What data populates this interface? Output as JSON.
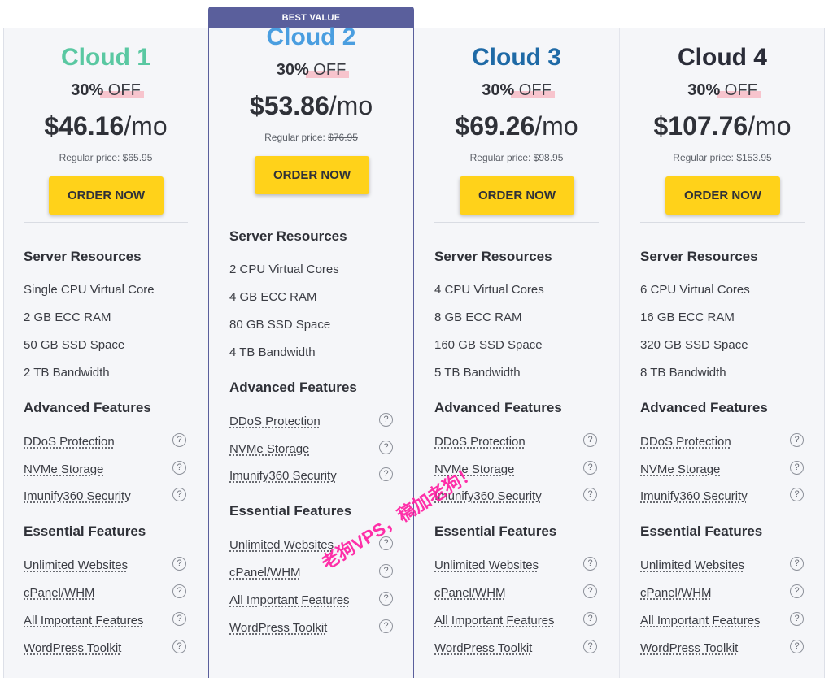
{
  "badge": "BEST VALUE",
  "plans": [
    {
      "name": "Cloud 1",
      "name_color": "#5ac8a2",
      "discount_pct": "30%",
      "discount_off": "OFF",
      "price": "$46.16",
      "per": "/mo",
      "regular_label": "Regular price:",
      "regular_price": "$65.95",
      "order_label": "ORDER NOW",
      "resources": [
        "Single CPU Virtual Core",
        "2 GB ECC RAM",
        "50 GB SSD Space",
        "2 TB Bandwidth"
      ]
    },
    {
      "name": "Cloud 2",
      "name_color": "#4a9ee0",
      "discount_pct": "30%",
      "discount_off": "OFF",
      "price": "$53.86",
      "per": "/mo",
      "regular_label": "Regular price:",
      "regular_price": "$76.95",
      "order_label": "ORDER NOW",
      "resources": [
        "2 CPU Virtual Cores",
        "4 GB ECC RAM",
        "80 GB SSD Space",
        "4 TB Bandwidth"
      ]
    },
    {
      "name": "Cloud 3",
      "name_color": "#1f6aa6",
      "discount_pct": "30%",
      "discount_off": "OFF",
      "price": "$69.26",
      "per": "/mo",
      "regular_label": "Regular price:",
      "regular_price": "$98.95",
      "order_label": "ORDER NOW",
      "resources": [
        "4 CPU Virtual Cores",
        "8 GB ECC RAM",
        "160 GB SSD Space",
        "5 TB Bandwidth"
      ]
    },
    {
      "name": "Cloud 4",
      "name_color": "#2a2c38",
      "discount_pct": "30%",
      "discount_off": "OFF",
      "price": "$107.76",
      "per": "/mo",
      "regular_label": "Regular price:",
      "regular_price": "$153.95",
      "order_label": "ORDER NOW",
      "resources": [
        "6 CPU Virtual Cores",
        "16 GB ECC RAM",
        "320 GB SSD Space",
        "8 TB Bandwidth"
      ]
    }
  ],
  "sections": {
    "resources": "Server Resources",
    "advanced": "Advanced Features",
    "essential": "Essential Features"
  },
  "advanced_features": [
    "DDoS Protection",
    "NVMe Storage",
    "Imunify360 Security"
  ],
  "essential_features": [
    "Unlimited Websites",
    "cPanel/WHM",
    "All Important Features",
    "WordPress Toolkit"
  ],
  "help_icon": "question-circle-icon",
  "help_glyph": "?",
  "colors": {
    "accent_button": "#ffd21a",
    "badge_bg": "#5a5f9c",
    "discount_highlight": "#f7b3bd",
    "watermark": "#ff1aa0"
  },
  "watermark": "老狗VPS，稿加老狗！"
}
